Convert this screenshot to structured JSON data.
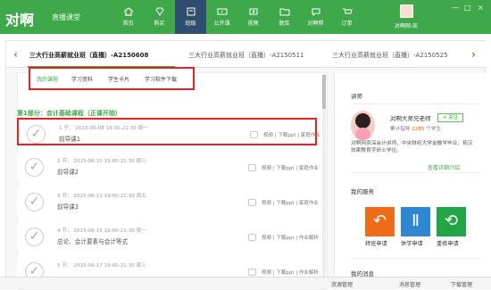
{
  "app": {
    "logo": "对啊",
    "subtitle": "直播课堂",
    "nav": [
      {
        "label": "首页",
        "icon": "home-icon"
      },
      {
        "label": "购买",
        "icon": "diamond-icon"
      },
      {
        "label": "班级",
        "icon": "class-icon"
      },
      {
        "label": "公开课",
        "icon": "open-course-icon"
      },
      {
        "label": "视频",
        "icon": "video-icon"
      },
      {
        "label": "题库",
        "icon": "question-bank-icon"
      },
      {
        "label": "对啊帮",
        "icon": "help-chat-icon"
      },
      {
        "label": "订单",
        "icon": "order-cart-icon"
      }
    ],
    "user": "对啊网-凯",
    "window_controls": [
      "—",
      "□",
      "×"
    ],
    "accent": "#3fa84a",
    "highlight": "#ef1f1f"
  },
  "class_bar": {
    "prev": "‹",
    "next": "›",
    "classes": [
      "三大行业高薪就业班（直播）-A2150608",
      "三大行业高薪就业班（直播）-A2150511",
      "三大行业高薪就业班（直播）-A2150525"
    ]
  },
  "course": {
    "tabs": [
      "我的课程",
      "学习资料",
      "学生卡片",
      "学习软件下载"
    ],
    "section": "第1部分：会计基础课程（正课开始）",
    "lessons": [
      {
        "meta": "1 节：  2015-06-08 19:00-21:30   周一",
        "title": "前导课1",
        "actions": "视频  |  下载ppt  |  家庭作业"
      },
      {
        "meta": "2 节：  2015-06-10 19:00-21:30   周三",
        "title": "前导课2",
        "actions": "视频  |  下载ppt  |  家庭作业"
      },
      {
        "meta": "3 节：  2015-06-12 19:00-21:30   周五",
        "title": "前导课3",
        "actions": "视频  |  下载ppt  |  家庭作业"
      },
      {
        "meta": "4 节：  2015-06-15 19:00-21:30   周一",
        "title": "总论、会计要素与会计等式",
        "actions": "视频  |  下载ppt  |  作业解析"
      },
      {
        "meta": "5 节：  2015-06-17 19:00-21:30   周三",
        "title": "",
        "actions": "视频  |  下载ppt  |  作业解析"
      }
    ]
  },
  "sidebar": {
    "teacher_heading": "讲师",
    "teacher_name": "对啊大师兄老师",
    "follow": "+ 关注",
    "student_count_prefix": "累计指导",
    "student_count": "2285",
    "student_count_suffix": "个学生",
    "description": "对啊网资深会计讲师，中央财经大学金融学毕业，拓汉效果教育字研士学位。",
    "more": "查看详细介绍",
    "service_heading": "我的服务",
    "services": [
      {
        "label": "转班申请",
        "icon": "transfer-icon",
        "color": "#ef6b18"
      },
      {
        "label": "休学申请",
        "icon": "pause-study-icon",
        "color": "#2f86d1"
      },
      {
        "label": "重修申请",
        "icon": "repeat-course-icon",
        "color": "#23a547"
      }
    ],
    "message_heading": "我的消息"
  },
  "bottom_bar": [
    "资源管理",
    "消息管理",
    "下载管理"
  ]
}
